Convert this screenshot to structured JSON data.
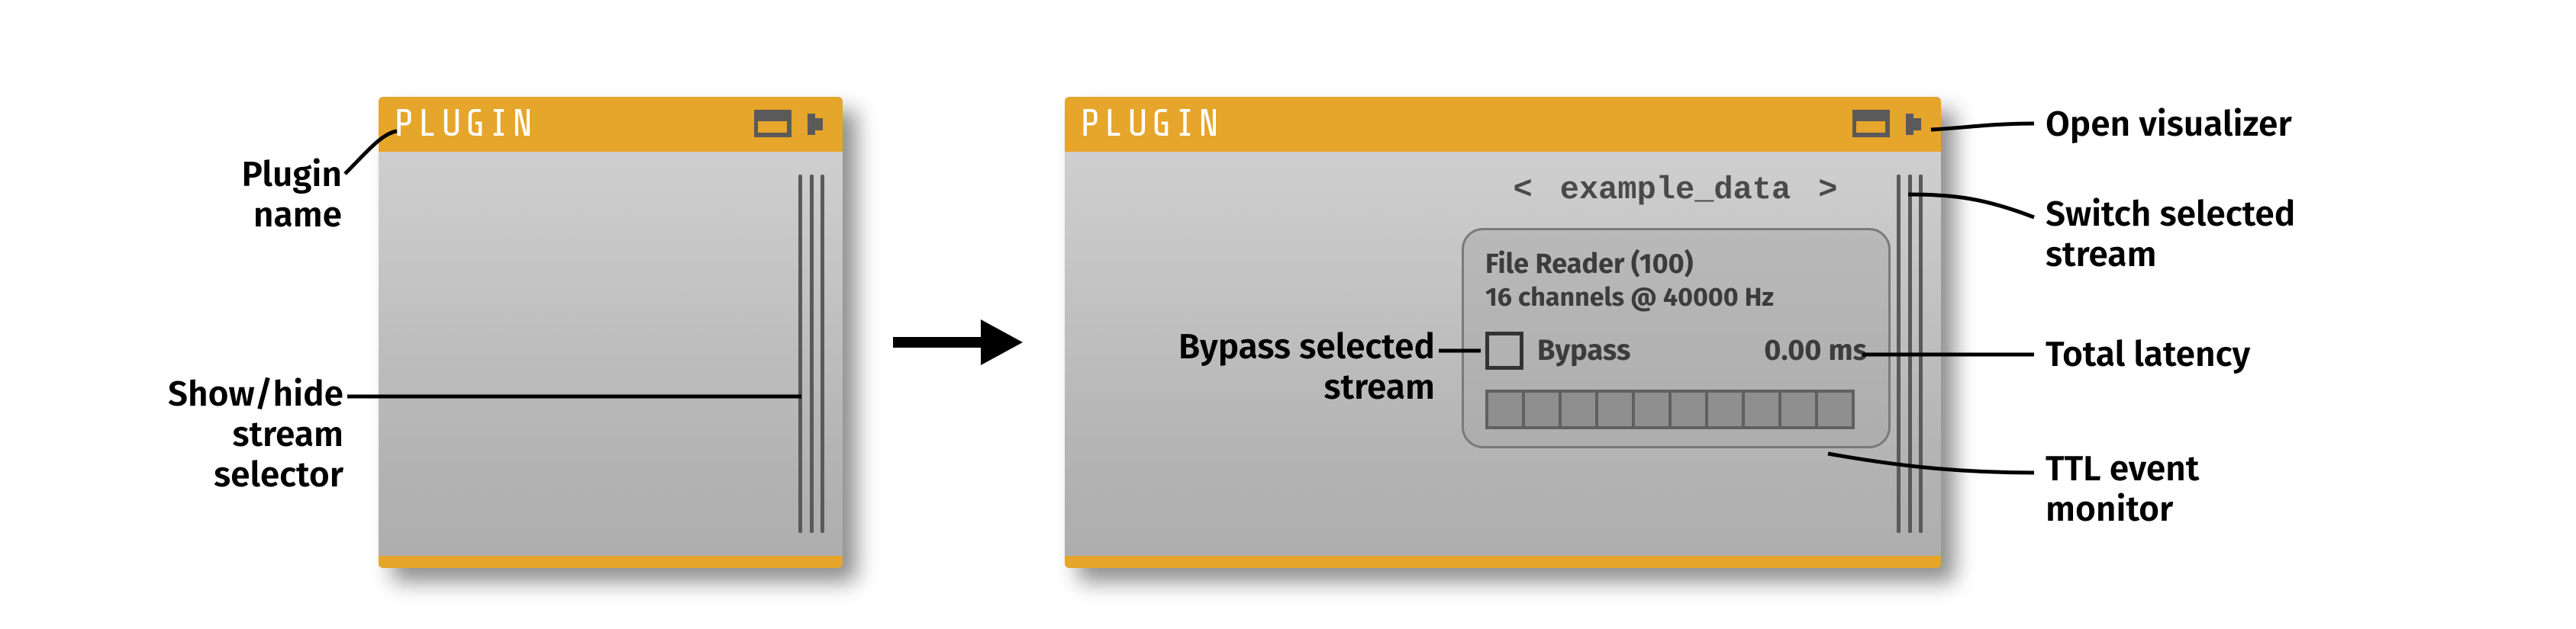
{
  "left_plugin": {
    "title": "PLUGIN"
  },
  "right_plugin": {
    "title": "PLUGIN",
    "stream_nav": {
      "prev": "<",
      "name": "example_data",
      "next": ">"
    },
    "panel": {
      "source": "File Reader (100)",
      "channels": "16 channels @ 40000 Hz",
      "bypass_label": "Bypass",
      "latency": "0.00 ms",
      "ttl_slots": 10
    }
  },
  "annotations": {
    "plugin_name": "Plugin\nname",
    "show_hide": "Show/hide\nstream\nselector",
    "bypass": "Bypass selected\nstream",
    "open_visualizer": "Open visualizer",
    "switch_stream": "Switch selected\nstream",
    "total_latency": "Total latency",
    "ttl_monitor": "TTL event\nmonitor"
  }
}
